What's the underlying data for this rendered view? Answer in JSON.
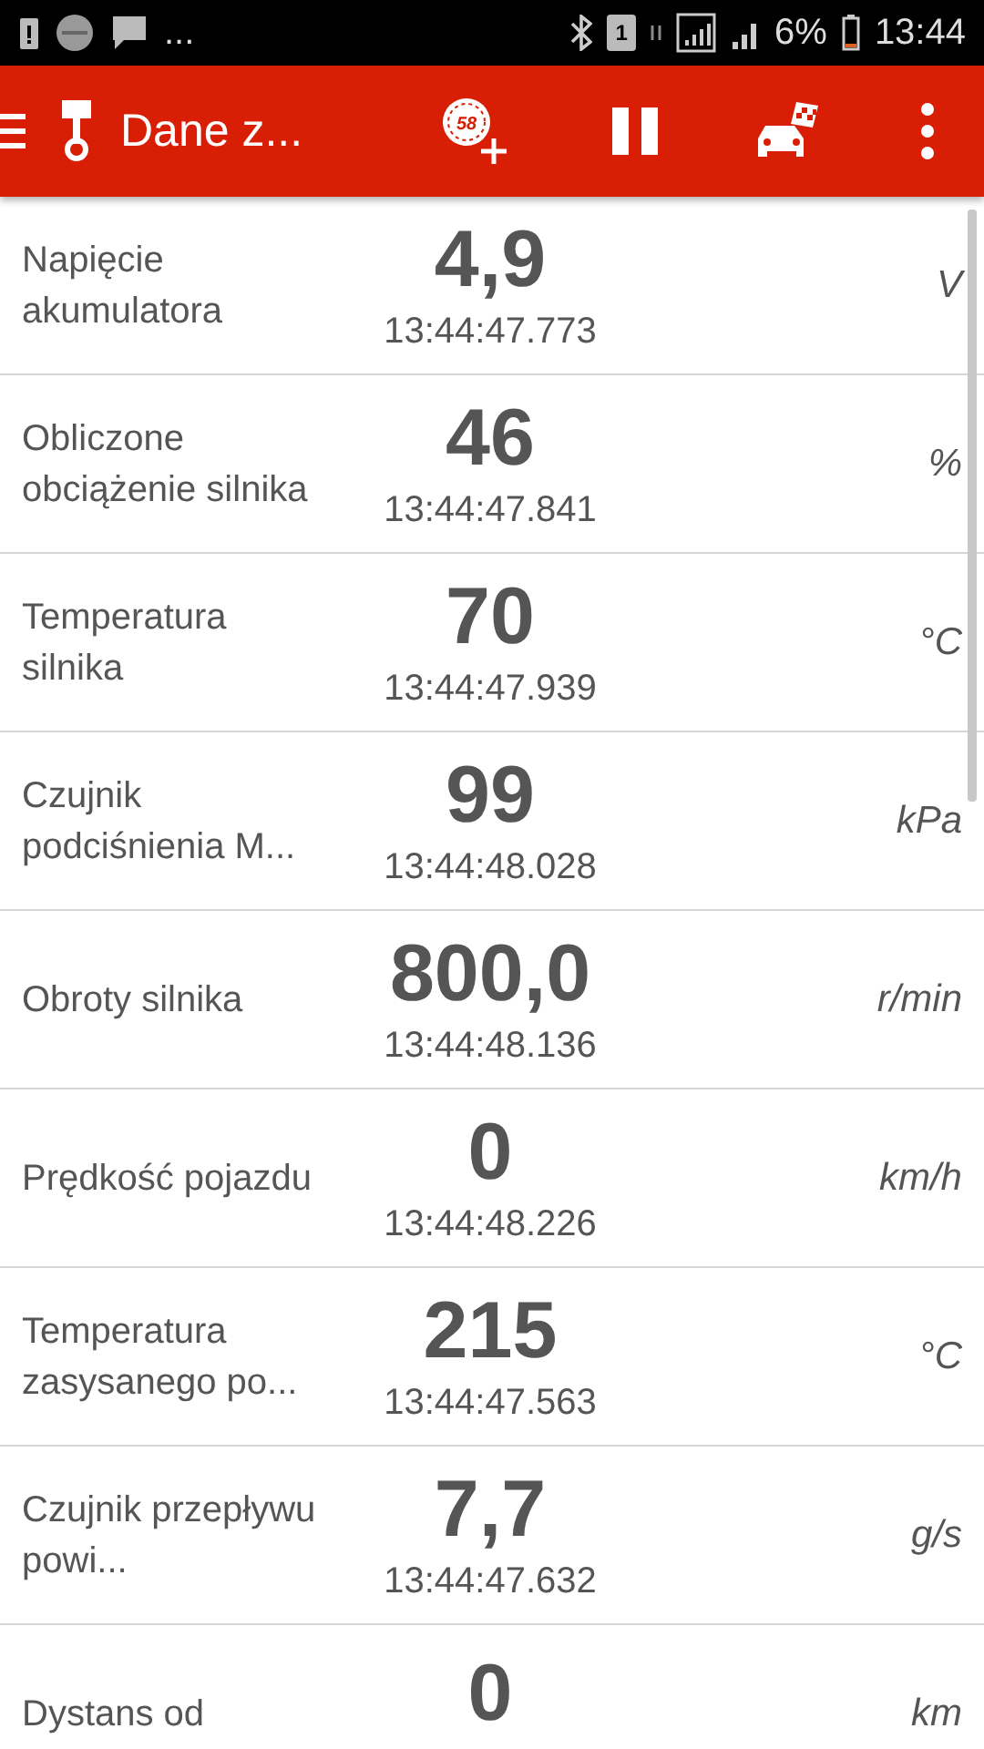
{
  "status_bar": {
    "notification_more": "...",
    "sim_slot": "1",
    "battery": "6%",
    "time": "13:44"
  },
  "toolbar": {
    "title": "Dane z...",
    "gauge_badge": "58"
  },
  "rows": [
    {
      "label": "Napięcie akumulatora",
      "value": "4,9",
      "timestamp": "13:44:47.773",
      "unit": "V"
    },
    {
      "label": "Obliczone obciążenie silnika",
      "value": "46",
      "timestamp": "13:44:47.841",
      "unit": "%"
    },
    {
      "label": "Temperatura silnika",
      "value": "70",
      "timestamp": "13:44:47.939",
      "unit": "°C"
    },
    {
      "label": "Czujnik podciśnienia M...",
      "value": "99",
      "timestamp": "13:44:48.028",
      "unit": "kPa"
    },
    {
      "label": "Obroty silnika",
      "value": "800,0",
      "timestamp": "13:44:48.136",
      "unit": "r/min"
    },
    {
      "label": "Prędkość pojazdu",
      "value": "0",
      "timestamp": "13:44:48.226",
      "unit": "km/h"
    },
    {
      "label": "Temperatura zasysanego po...",
      "value": "215",
      "timestamp": "13:44:47.563",
      "unit": "°C"
    },
    {
      "label": "Czujnik przepływu powi...",
      "value": "7,7",
      "timestamp": "13:44:47.632",
      "unit": "g/s"
    },
    {
      "label": "Dystans od",
      "value": "0",
      "unit": "km"
    }
  ]
}
